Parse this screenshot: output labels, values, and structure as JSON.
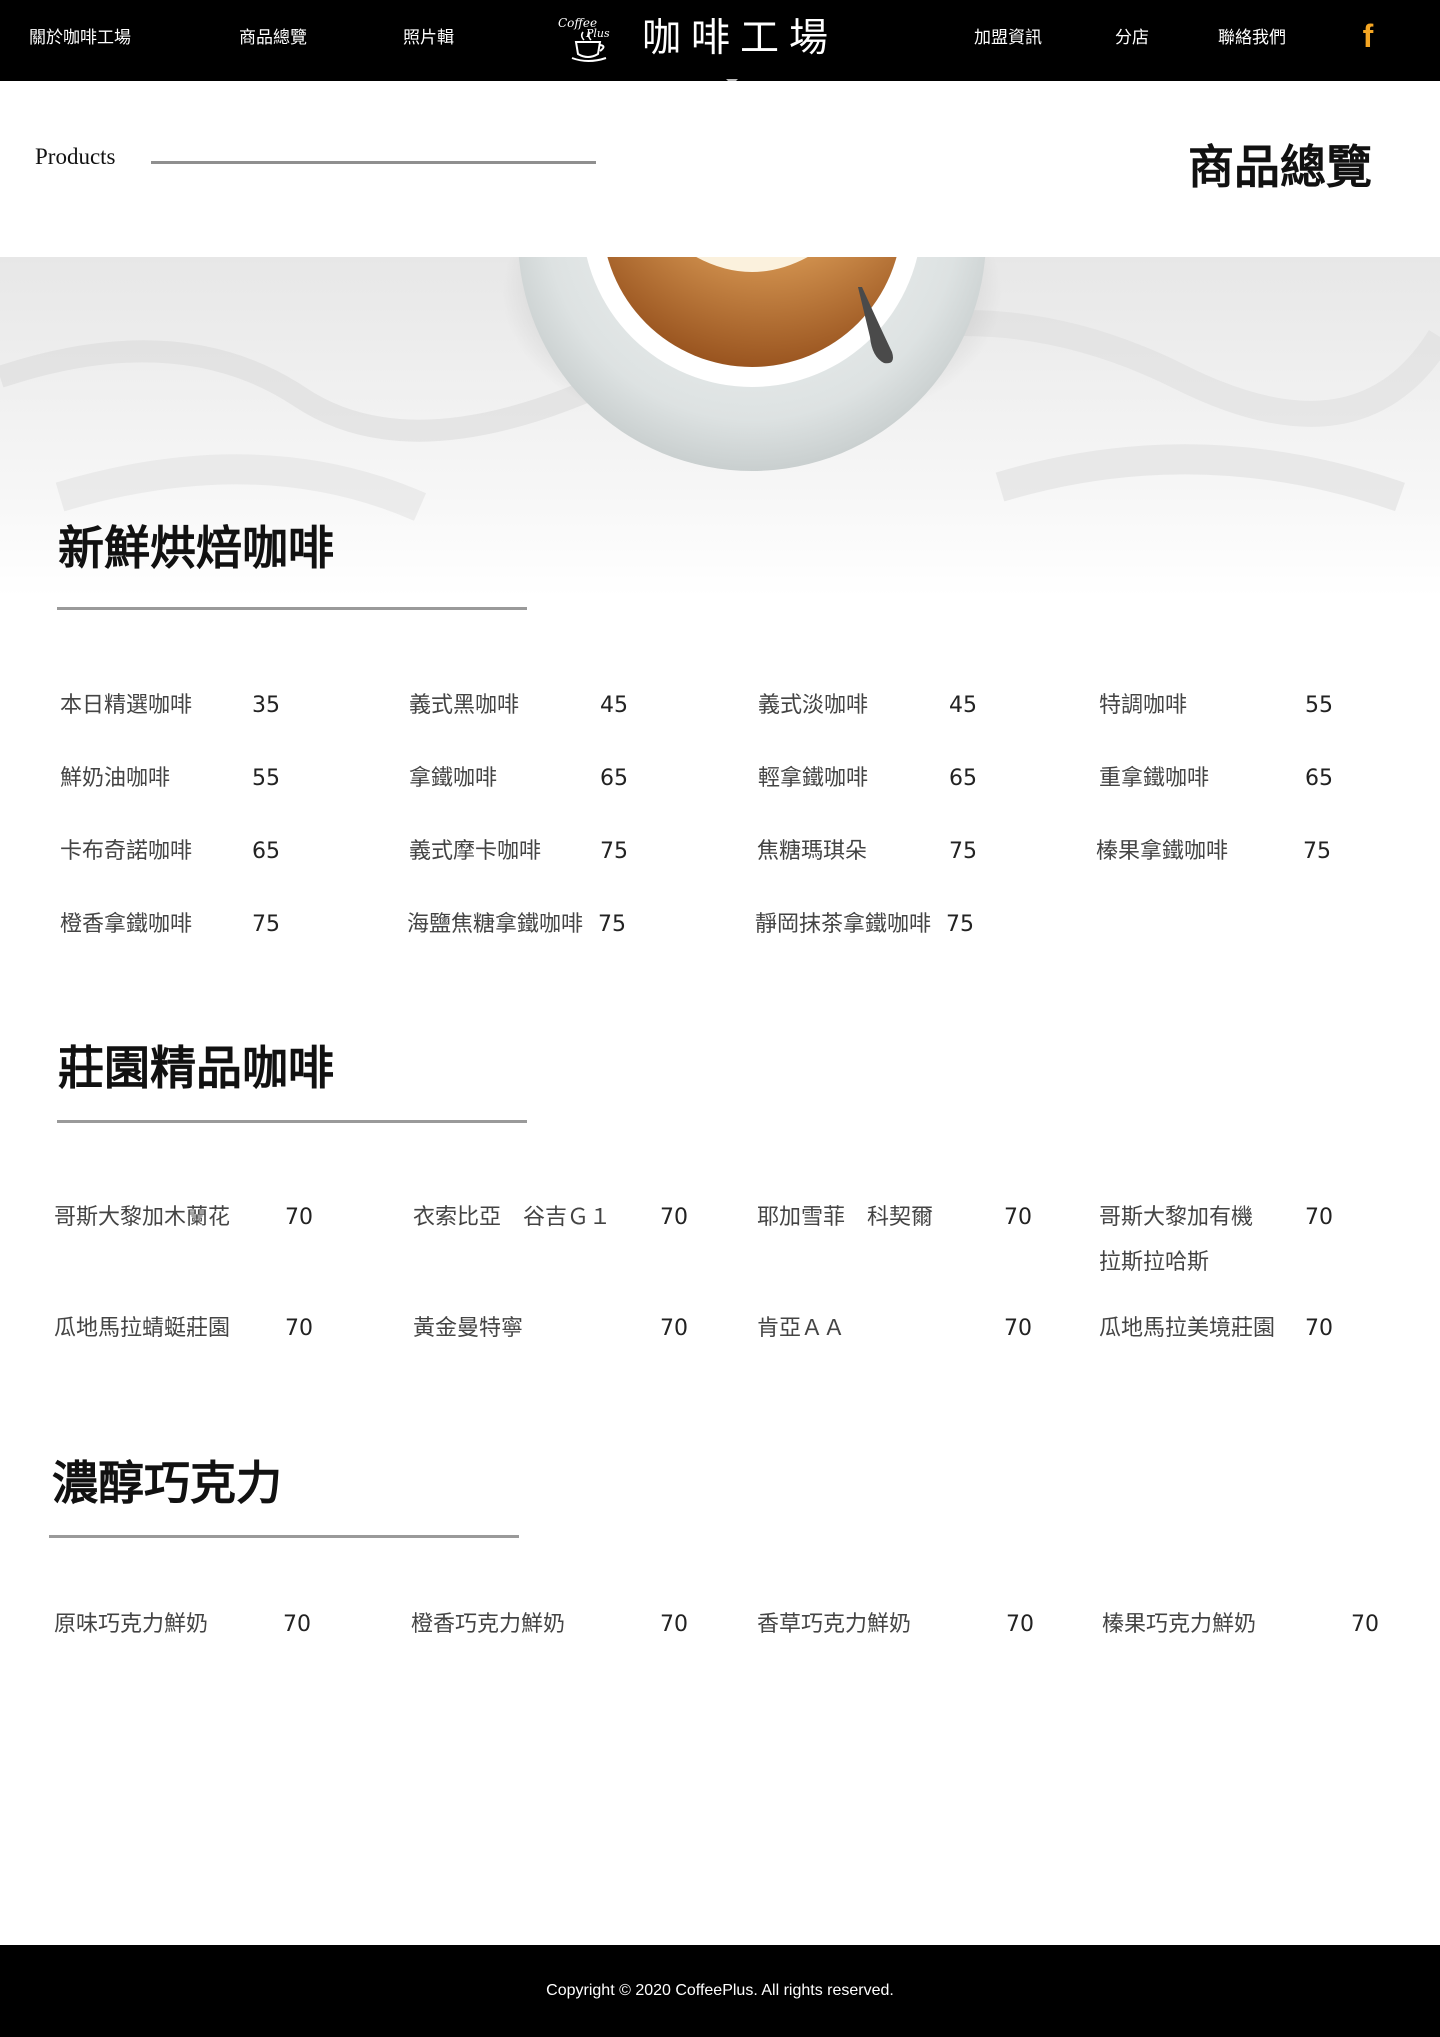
{
  "header": {
    "nav_left": [
      "關於咖啡工場",
      "商品總覽",
      "照片輯"
    ],
    "nav_right": [
      "加盟資訊",
      "分店",
      "聯絡我們"
    ],
    "brand_name": "咖啡工場",
    "logo_text": [
      "Coffee",
      "Plus"
    ],
    "facebook_icon": "facebook-f-icon",
    "facebook_color": "#f5a623"
  },
  "page": {
    "products_label": "Products",
    "title": "商品總覽"
  },
  "sections": [
    {
      "title": "新鮮烘焙咖啡",
      "items": [
        {
          "name": "本日精選咖啡",
          "price": "35"
        },
        {
          "name": "義式黑咖啡",
          "price": "45"
        },
        {
          "name": "義式淡咖啡",
          "price": "45"
        },
        {
          "name": "特調咖啡",
          "price": "55"
        },
        {
          "name": "鮮奶油咖啡",
          "price": "55"
        },
        {
          "name": "拿鐵咖啡",
          "price": "65"
        },
        {
          "name": "輕拿鐵咖啡",
          "price": "65"
        },
        {
          "name": "重拿鐵咖啡",
          "price": "65"
        },
        {
          "name": "卡布奇諾咖啡",
          "price": "65"
        },
        {
          "name": "義式摩卡咖啡",
          "price": "75"
        },
        {
          "name": "焦糖瑪琪朵",
          "price": "75"
        },
        {
          "name": "榛果拿鐵咖啡",
          "price": "75"
        },
        {
          "name": "橙香拿鐵咖啡",
          "price": "75"
        },
        {
          "name": "海鹽焦糖拿鐵咖啡",
          "price": "75"
        },
        {
          "name": "靜岡抹茶拿鐵咖啡",
          "price": "75"
        }
      ]
    },
    {
      "title": "莊園精品咖啡",
      "items": [
        {
          "name": "哥斯大黎加木蘭花",
          "price": "70"
        },
        {
          "name": "衣索比亞　谷吉Ｇ１",
          "price": "70"
        },
        {
          "name": "耶加雪菲　科契爾",
          "price": "70"
        },
        {
          "name": "哥斯大黎加有機",
          "name2": "拉斯拉哈斯",
          "price": "70"
        },
        {
          "name": "瓜地馬拉蜻蜓莊園",
          "price": "70"
        },
        {
          "name": "黃金曼特寧",
          "price": "70"
        },
        {
          "name": "肯亞ＡＡ",
          "price": "70"
        },
        {
          "name": "瓜地馬拉美境莊園",
          "price": "70"
        }
      ]
    },
    {
      "title": "濃醇巧克力",
      "items": [
        {
          "name": "原味巧克力鮮奶",
          "price": "70"
        },
        {
          "name": "橙香巧克力鮮奶",
          "price": "70"
        },
        {
          "name": "香草巧克力鮮奶",
          "price": "70"
        },
        {
          "name": "榛果巧克力鮮奶",
          "price": "70"
        }
      ]
    }
  ],
  "footer": {
    "copyright": "Copyright © 2020 CoffeePlus. All rights reserved."
  },
  "colors": {
    "header_bg": "#000000",
    "accent": "#f5a623",
    "divider": "#9a9a9a",
    "footer_bg": "#000000"
  }
}
